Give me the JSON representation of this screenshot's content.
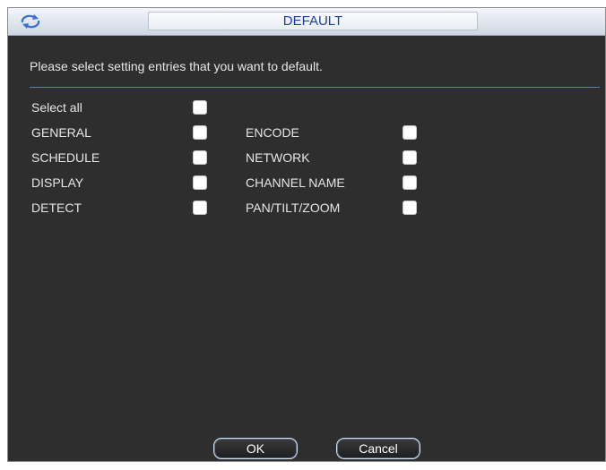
{
  "window": {
    "title": "DEFAULT",
    "title_icon": "refresh-icon"
  },
  "dialog": {
    "prompt": "Please select setting entries that you want to default."
  },
  "options": {
    "select_all": {
      "label": "Select all",
      "checked": false
    },
    "left": [
      {
        "label": "GENERAL",
        "checked": false
      },
      {
        "label": "SCHEDULE",
        "checked": false
      },
      {
        "label": "DISPLAY",
        "checked": false
      },
      {
        "label": "DETECT",
        "checked": false
      }
    ],
    "right": [
      {
        "label": "ENCODE",
        "checked": false
      },
      {
        "label": "NETWORK",
        "checked": false
      },
      {
        "label": "CHANNEL NAME",
        "checked": false
      },
      {
        "label": "PAN/TILT/ZOOM",
        "checked": false
      }
    ]
  },
  "buttons": {
    "ok_label": "OK",
    "cancel_label": "Cancel"
  },
  "colors": {
    "background": "#2e2e2e",
    "title_text": "#1a3fa0",
    "label_text": "#e6e6e6",
    "divider": "#5c7fae"
  }
}
